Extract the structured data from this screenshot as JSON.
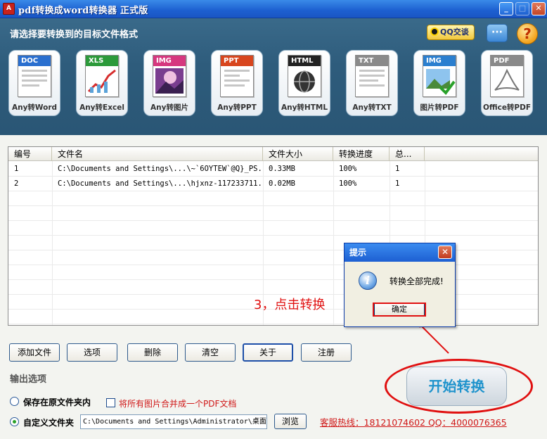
{
  "window": {
    "title": "pdf转换成word转换器 正式版",
    "icon_label": "A",
    "minimize_label": "_",
    "maximize_label": "□",
    "close_label": "✕"
  },
  "header": {
    "title": "请选择要转换到的目标文件格式",
    "qq_badge": "QQ交谈",
    "chat_label": "···",
    "help_label": "?"
  },
  "formats": [
    {
      "badge": "DOC",
      "label": "Any转Word",
      "color": "#2a6fcf"
    },
    {
      "badge": "XLS",
      "label": "Any转Excel",
      "color": "#2c9a3a"
    },
    {
      "badge": "IMG",
      "label": "Any转图片",
      "color": "#d6387f"
    },
    {
      "badge": "PPT",
      "label": "Any转PPT",
      "color": "#d8461e"
    },
    {
      "badge": "HTML",
      "label": "Any转HTML",
      "color": "#222222"
    },
    {
      "badge": "TXT",
      "label": "Any转TXT",
      "color": "#8a8a8a"
    },
    {
      "badge": "IMG",
      "label": "图片转PDF",
      "color": "#2b7fcf"
    },
    {
      "badge": "PDF",
      "label": "Office转PDF",
      "color": "#8a8a8a"
    }
  ],
  "table": {
    "columns": [
      "编号",
      "文件名",
      "文件大小",
      "转换进度",
      "总..."
    ],
    "rows": [
      {
        "id": "1",
        "name": "C:\\Documents and Settings\\...\\~`6OYTEW`@Q}_PS...",
        "size": "0.33MB",
        "progress": "100%",
        "total": "1"
      },
      {
        "id": "2",
        "name": "C:\\Documents and Settings\\...\\hjxnz-117233711...",
        "size": "0.02MB",
        "progress": "100%",
        "total": "1"
      }
    ]
  },
  "buttons": {
    "add_file": "添加文件",
    "options": "选项",
    "delete": "删除",
    "clear": "清空",
    "about": "关于",
    "register": "注册",
    "browse": "浏览",
    "start": "开始转换"
  },
  "output": {
    "section_title": "输出选项",
    "save_original": "保存在原文件夹内",
    "merge_images": "将所有图片合并成一个PDF文档",
    "custom_folder": "自定义文件夹",
    "path": "C:\\Documents and Settings\\Administrator\\桌面",
    "hotline": "客服热线：18121074602 QQ：4000076365"
  },
  "annotation": "3，点击转换",
  "dialog": {
    "title": "提示",
    "message": "转换全部完成!",
    "ok": "确定",
    "close_label": "✕",
    "info_glyph": "i"
  }
}
